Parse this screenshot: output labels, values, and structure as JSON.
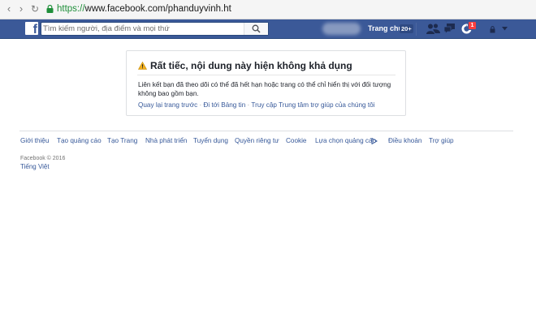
{
  "browser": {
    "url_scheme": "https://",
    "url_rest": "www.facebook.com/phanduyvinh.ht",
    "icons": [
      "back-arrow",
      "forward-arrow",
      "reload",
      "lock"
    ]
  },
  "topbar": {
    "logo": "f",
    "search_placeholder": "Tìm kiếm người, địa điểm và mọi thứ",
    "home_label": "Trang chủ",
    "home_count": "20+",
    "notifications_count": "1",
    "icons": [
      "search-icon",
      "friends-icon",
      "messages-icon",
      "notifications-icon",
      "privacy-icon",
      "caret-down-icon"
    ],
    "colors": {
      "bar": "#3b5998",
      "badge": "#fa3e3e"
    }
  },
  "card": {
    "title": "Rất tiếc, nội dung này hiện không khả dụng",
    "body": "Liên kết bạn đã theo dõi có thể đã hết hạn hoặc trang có thể chỉ hiển thị với đối tượng không bao gồm bạn.",
    "links": [
      "Quay lại trang trước",
      "Đi tới Bảng tin",
      "Truy cập Trung tâm trợ giúp của chúng tôi"
    ],
    "separator": " · "
  },
  "footer": {
    "links": [
      "Giới thiệu",
      "Tạo quảng cáo",
      "Tạo Trang",
      "Nhà phát triển",
      "Tuyển dụng",
      "Quyền riêng tư",
      "Cookie",
      "Lựa chọn quảng cáo",
      "Điều khoản",
      "Trợ giúp"
    ],
    "copyright": "Facebook © 2016",
    "language": "Tiếng Việt"
  }
}
